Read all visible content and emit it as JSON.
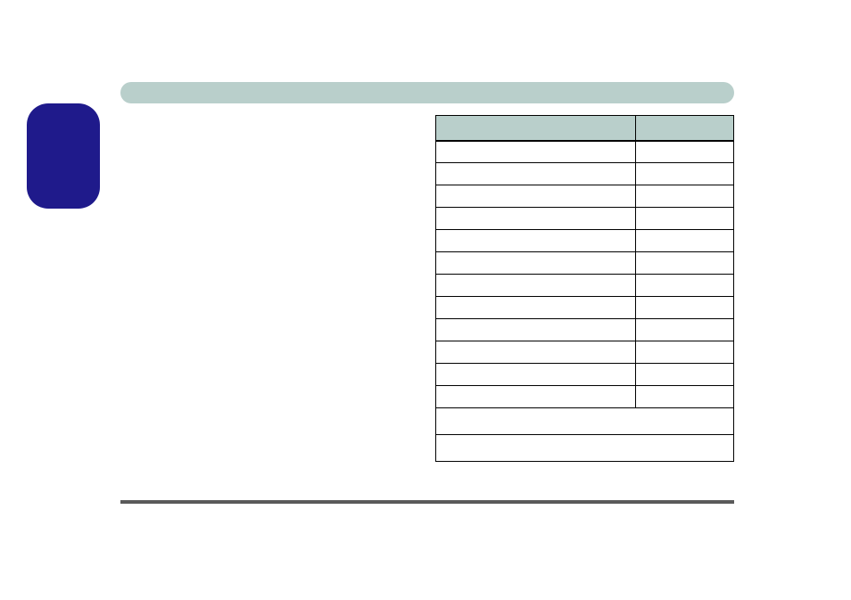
{
  "header": {
    "title": ""
  },
  "sidebar": {
    "badge_text": ""
  },
  "table": {
    "headers": {
      "left": "",
      "right": ""
    },
    "rows": [
      {
        "label": "",
        "value": ""
      },
      {
        "label": "",
        "value": ""
      },
      {
        "label": "",
        "value": ""
      },
      {
        "label": "",
        "value": ""
      },
      {
        "label": "",
        "value": ""
      },
      {
        "label": "",
        "value": ""
      },
      {
        "label": "",
        "value": ""
      },
      {
        "label": "",
        "value": ""
      },
      {
        "label": "",
        "value": ""
      },
      {
        "label": "",
        "value": ""
      },
      {
        "label": "",
        "value": ""
      },
      {
        "label": "",
        "value": ""
      }
    ],
    "summary": [
      {
        "text": ""
      },
      {
        "text": ""
      }
    ]
  },
  "footer": {
    "text": ""
  }
}
